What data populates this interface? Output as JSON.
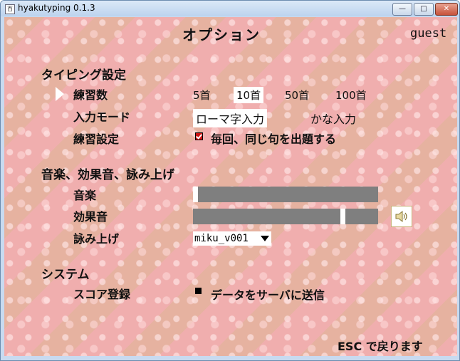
{
  "window": {
    "title": "hyakutyping 0.1.3",
    "min_glyph": "—",
    "max_glyph": "□",
    "close_glyph": "✕"
  },
  "page": {
    "title": "オプション",
    "user": "guest",
    "footer": "ESC で戻ります"
  },
  "typing": {
    "heading": "タイピング設定",
    "practice_count": {
      "label": "練習数",
      "options": [
        "5首",
        "10首",
        "50首",
        "100首"
      ],
      "selected": "10首"
    },
    "input_mode": {
      "label": "入力モード",
      "options": [
        "ローマ字入力",
        "かな入力"
      ],
      "selected": "ローマ字入力"
    },
    "practice_setting": {
      "label": "練習設定",
      "checkbox_label": "毎回、同じ句を出題する",
      "checked": true
    }
  },
  "sound": {
    "heading": "音楽、効果音、詠み上げ",
    "music": {
      "label": "音楽",
      "level": 0
    },
    "sfx": {
      "label": "効果音",
      "level": 0.81,
      "icon": "speaker-icon"
    },
    "reading": {
      "label": "詠み上げ",
      "value": "miku_v001"
    }
  },
  "system": {
    "heading": "システム",
    "score": {
      "label": "スコア登録",
      "checkbox_label": "データをサーバに送信",
      "checked": false
    }
  }
}
